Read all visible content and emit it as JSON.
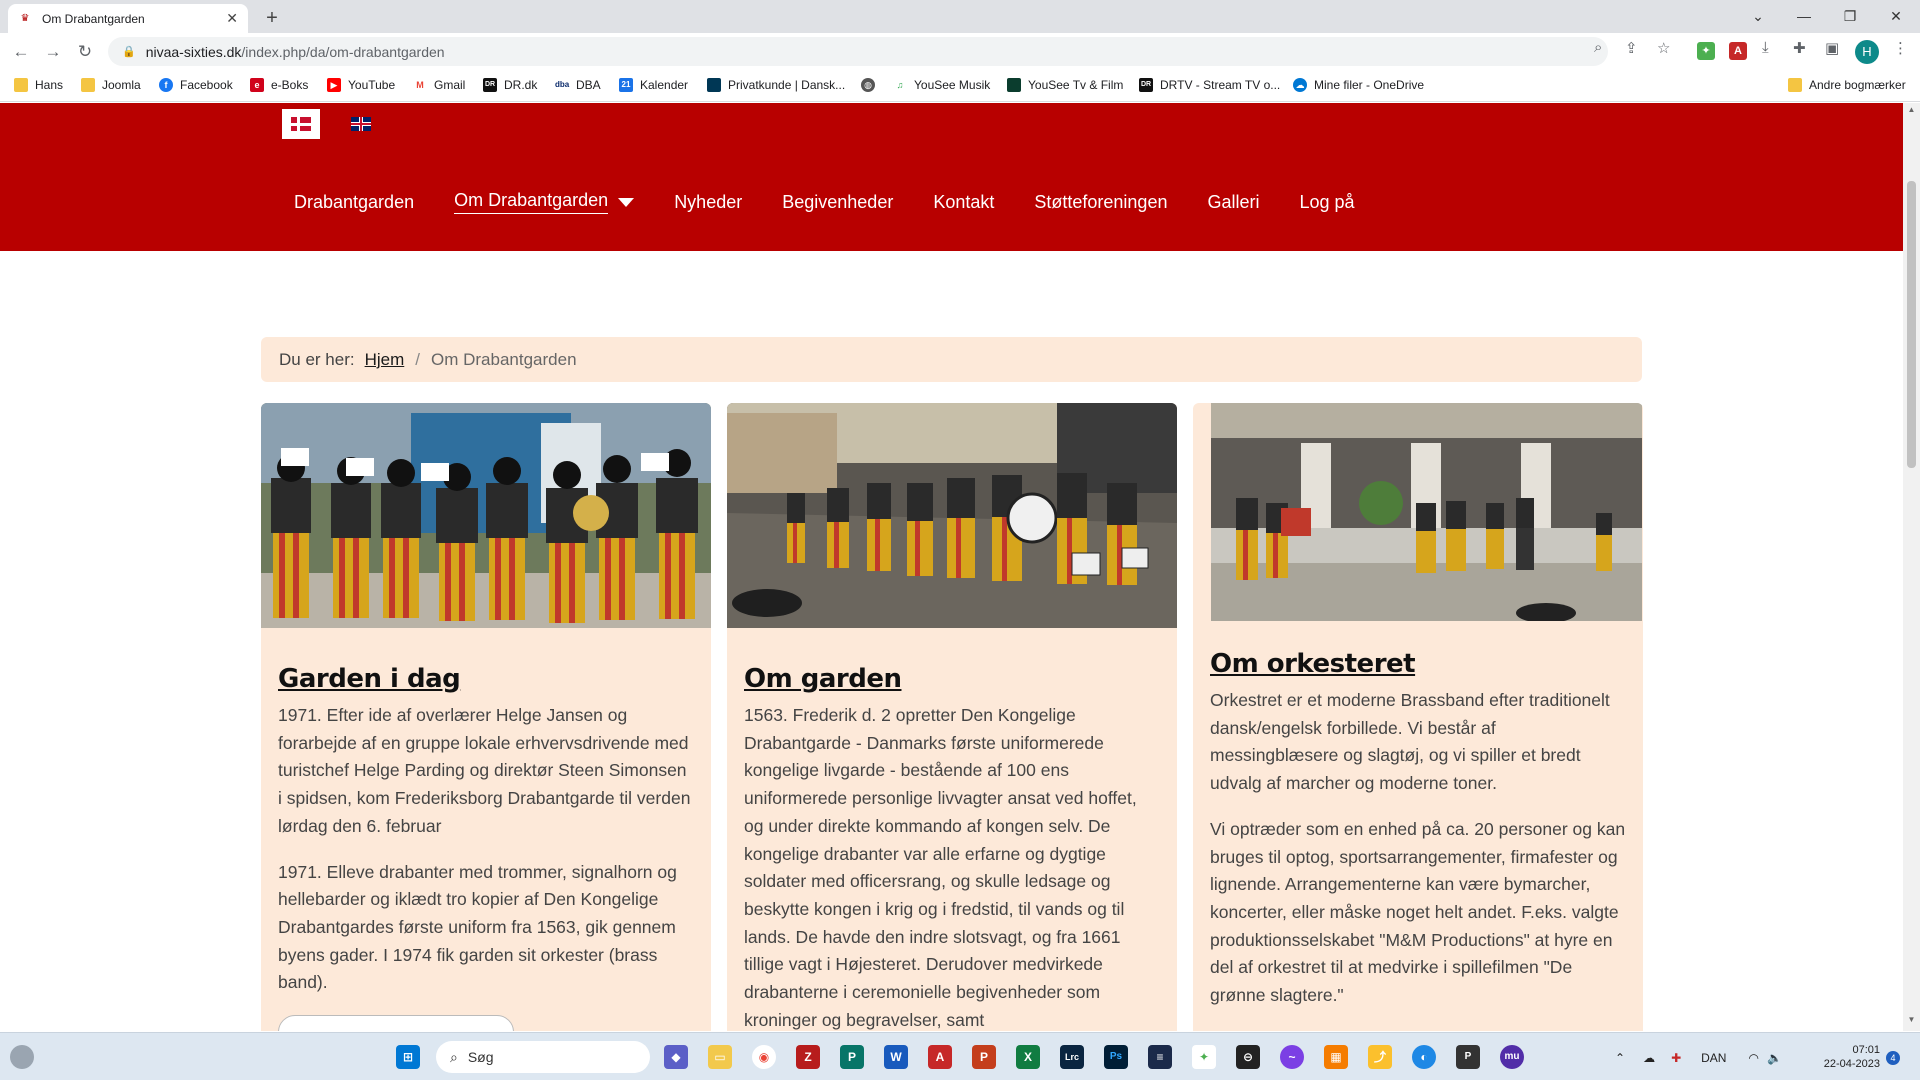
{
  "browser": {
    "tab_title": "Om Drabantgarden",
    "url_host": "nivaa-sixties.dk",
    "url_path": "/index.php/da/om-drabantgarden",
    "profile_initial": "H",
    "bookmarks": [
      {
        "label": "Hans",
        "icon": "folder-icon",
        "color": "#f4c542"
      },
      {
        "label": "Joomla",
        "icon": "folder-icon",
        "color": "#f4c542"
      },
      {
        "label": "Facebook",
        "icon": "facebook-icon",
        "color": "#1877f2"
      },
      {
        "label": "e-Boks",
        "icon": "eboks-icon",
        "color": "#d0021b"
      },
      {
        "label": "YouTube",
        "icon": "youtube-icon",
        "color": "#ff0000"
      },
      {
        "label": "Gmail",
        "icon": "gmail-icon",
        "color": "#ea4335"
      },
      {
        "label": "DR.dk",
        "icon": "dr-icon",
        "color": "#111111"
      },
      {
        "label": "DBA",
        "icon": "dba-icon",
        "color": "#0a2a6b"
      },
      {
        "label": "Kalender",
        "icon": "calendar-icon",
        "color": "#1a73e8"
      },
      {
        "label": "Privatkunde | Dansk...",
        "icon": "bank-icon",
        "color": "#003755"
      },
      {
        "label": "",
        "icon": "globe-icon",
        "color": "#555555"
      },
      {
        "label": "YouSee Musik",
        "icon": "music-icon",
        "color": "#34a853"
      },
      {
        "label": "YouSee Tv & Film",
        "icon": "tv-icon",
        "color": "#0b3d2e"
      },
      {
        "label": "DRTV - Stream TV o...",
        "icon": "drtv-icon",
        "color": "#111111"
      },
      {
        "label": "Mine filer - OneDrive",
        "icon": "onedrive-icon",
        "color": "#0078d4"
      }
    ],
    "other_bookmarks": "Andre bogmærker"
  },
  "site": {
    "brand_color": "#b80000",
    "nav": [
      {
        "label": "Drabantgarden",
        "active": false
      },
      {
        "label": "Om Drabantgarden",
        "active": true
      },
      {
        "label": "Nyheder",
        "active": false
      },
      {
        "label": "Begivenheder",
        "active": false
      },
      {
        "label": "Kontakt",
        "active": false
      },
      {
        "label": "Støtteforeningen",
        "active": false
      },
      {
        "label": "Galleri",
        "active": false
      },
      {
        "label": "Log på",
        "active": false
      }
    ],
    "breadcrumb": {
      "prefix": "Du er her:",
      "home": "Hjem",
      "separator": "/",
      "current": "Om Drabantgarden"
    },
    "cards": [
      {
        "title": "Garden i dag",
        "paragraphs": [
          "1971. Efter ide af overlærer Helge Jansen og forarbejde af en gruppe lokale erhvervsdrivende med turistchef Helge Parding og direktør Steen Simonsen i spidsen, kom Frederiksborg Drabantgarde til verden lørdag den 6. februar",
          "1971. Elleve drabanter med trommer, signalhorn og hellebarder og iklædt tro kopier af Den Kongelige Drabantgardes første uniform fra 1563, gik gennem byens gader. I 1974 fik garden sit orkester (brass band)."
        ]
      },
      {
        "title": "Om garden",
        "paragraphs": [
          "1563. Frederik d. 2 opretter Den Kongelige Drabantgarde - Danmarks første uniformerede kongelige livgarde - bestående af 100 ens uniformerede personlige livvagter ansat ved hoffet, og under direkte kommando af kongen selv. De kongelige drabanter var alle erfarne og dygtige soldater med officersrang, og skulle ledsage og beskytte kongen i krig og i fredstid, til vands og til lands. De havde den indre slotsvagt, og fra 1661 tillige vagt i Højesteret. Derudover medvirkede drabanterne i ceremonielle begivenheder som kroninger og begravelser, samt"
        ]
      },
      {
        "title": "Om orkesteret",
        "paragraphs": [
          "Orkestret er et moderne Brassband efter traditionelt dansk/engelsk forbillede. Vi består af messingblæsere og slagtøj, og vi spiller et bredt udvalg af marcher og moderne toner.",
          "Vi optræder som en enhed på ca. 20 personer og kan bruges til optog, sportsarrangementer, firmafester og lignende. Arrangementerne kan være bymarcher, koncerter, eller måske noget helt andet. F.eks. valgte produktionsselskabet \"M&M Productions\" at hyre en del af orkestret til at medvirke i spillefilmen \"De grønne slagtere.\""
        ]
      }
    ]
  },
  "taskbar": {
    "search_placeholder": "Søg",
    "language": "DAN",
    "time": "07:01",
    "date": "22-04-2023",
    "notifications": "4"
  }
}
